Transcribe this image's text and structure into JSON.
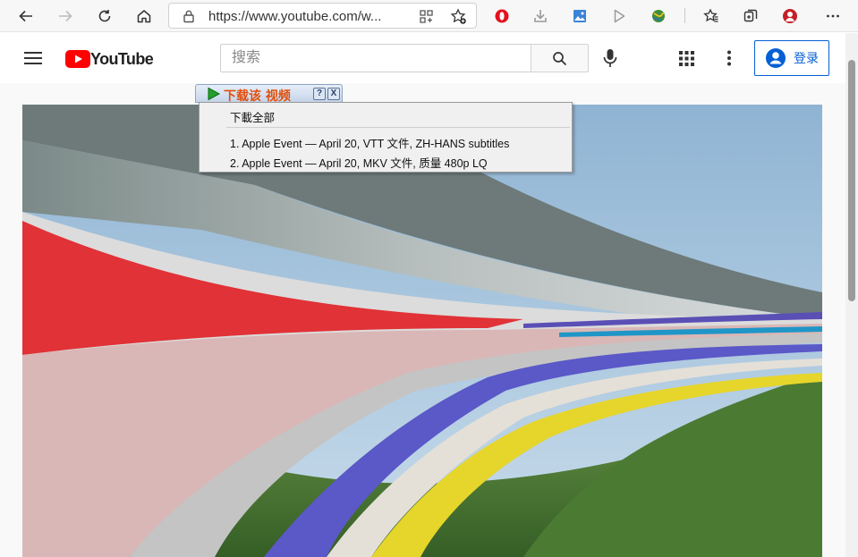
{
  "browser": {
    "url": "https://www.youtube.com/w...",
    "icons": [
      "back-icon",
      "forward-icon",
      "refresh-icon",
      "home-icon",
      "lock-icon",
      "reader-mode-icon",
      "add-favorite-icon",
      "opera-icon",
      "download-icon",
      "image-icon",
      "play-icon",
      "globe-icon",
      "favorites-icon",
      "collections-icon",
      "profile-icon"
    ]
  },
  "youtube": {
    "logo_text": "YouTube",
    "search_placeholder": "搜索",
    "signin_label": "登录",
    "colors": {
      "brand_red": "#ff0000",
      "accent_blue": "#065fd4"
    }
  },
  "download_helper": {
    "tab_label": "下载该 视频",
    "help_label": "?",
    "close_label": "X",
    "download_all": "下載全部",
    "items": [
      {
        "label": "1.  Apple Event — April 20,  VTT 文件, ZH-HANS subtitles"
      },
      {
        "label": "2.  Apple Event — April 20,  MKV 文件, 质量 480p LQ"
      }
    ]
  }
}
